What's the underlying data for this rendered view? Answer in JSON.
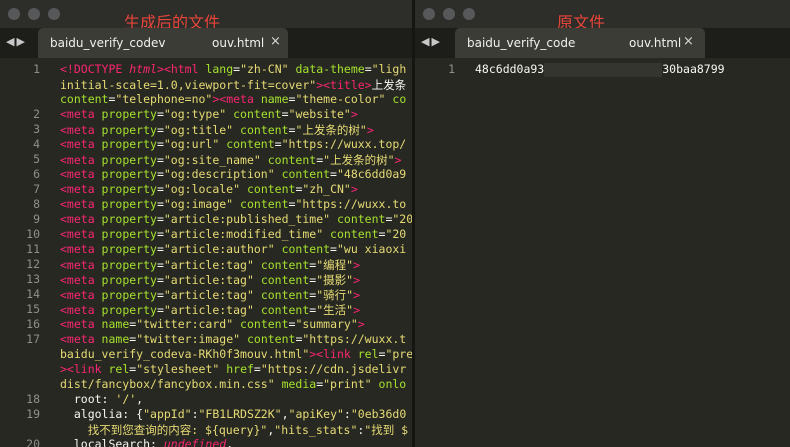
{
  "left_window": {
    "title": "生成后的文件",
    "tab_name_start": "baidu_verify_codev",
    "tab_name_end": "ouv.html",
    "close_icon": "×",
    "lines": [
      {
        "num": "1",
        "segments": [
          [
            "t",
            "<!DOCTYPE "
          ],
          [
            "i",
            "html"
          ],
          [
            "t",
            "><"
          ],
          [
            "t",
            "html "
          ],
          [
            "a",
            "lang"
          ],
          [
            "w",
            "="
          ],
          [
            "s",
            "\"zh-CN\" "
          ],
          [
            "a",
            "data-theme"
          ],
          [
            "w",
            "="
          ],
          [
            "s",
            "\"ligh"
          ]
        ]
      },
      {
        "num": "",
        "segments": [
          [
            "s",
            "initial-scale=1.0,viewport-fit=cover\""
          ],
          [
            "t",
            "><"
          ],
          [
            "t",
            "title"
          ],
          [
            "t",
            ">"
          ],
          [
            "w",
            "上发条"
          ]
        ]
      },
      {
        "num": "",
        "segments": [
          [
            "a",
            "content"
          ],
          [
            "w",
            "="
          ],
          [
            "s",
            "\"telephone=no\""
          ],
          [
            "t",
            "><"
          ],
          [
            "t",
            "meta "
          ],
          [
            "a",
            "name"
          ],
          [
            "w",
            "="
          ],
          [
            "s",
            "\"theme-color\" "
          ],
          [
            "a",
            "co"
          ]
        ]
      },
      {
        "num": "2",
        "segments": [
          [
            "t",
            "<meta "
          ],
          [
            "a",
            "property"
          ],
          [
            "w",
            "="
          ],
          [
            "s",
            "\"og:type\" "
          ],
          [
            "a",
            "content"
          ],
          [
            "w",
            "="
          ],
          [
            "s",
            "\"website\""
          ],
          [
            "t",
            ">"
          ]
        ]
      },
      {
        "num": "3",
        "segments": [
          [
            "t",
            "<meta "
          ],
          [
            "a",
            "property"
          ],
          [
            "w",
            "="
          ],
          [
            "s",
            "\"og:title\" "
          ],
          [
            "a",
            "content"
          ],
          [
            "w",
            "="
          ],
          [
            "s",
            "\"上发条的树\""
          ],
          [
            "t",
            ">"
          ]
        ]
      },
      {
        "num": "4",
        "segments": [
          [
            "t",
            "<meta "
          ],
          [
            "a",
            "property"
          ],
          [
            "w",
            "="
          ],
          [
            "s",
            "\"og:url\" "
          ],
          [
            "a",
            "content"
          ],
          [
            "w",
            "="
          ],
          [
            "s",
            "\"https://wuxx.top/"
          ]
        ]
      },
      {
        "num": "5",
        "segments": [
          [
            "t",
            "<meta "
          ],
          [
            "a",
            "property"
          ],
          [
            "w",
            "="
          ],
          [
            "s",
            "\"og:site_name\" "
          ],
          [
            "a",
            "content"
          ],
          [
            "w",
            "="
          ],
          [
            "s",
            "\"上发条的树\""
          ],
          [
            "t",
            "> "
          ]
        ]
      },
      {
        "num": "6",
        "segments": [
          [
            "t",
            "<meta "
          ],
          [
            "a",
            "property"
          ],
          [
            "w",
            "="
          ],
          [
            "s",
            "\"og:description\" "
          ],
          [
            "a",
            "content"
          ],
          [
            "w",
            "="
          ],
          [
            "s",
            "\"48c6dd0a9"
          ]
        ]
      },
      {
        "num": "7",
        "segments": [
          [
            "t",
            "<meta "
          ],
          [
            "a",
            "property"
          ],
          [
            "w",
            "="
          ],
          [
            "s",
            "\"og:locale\" "
          ],
          [
            "a",
            "content"
          ],
          [
            "w",
            "="
          ],
          [
            "s",
            "\"zh_CN\""
          ],
          [
            "t",
            ">"
          ]
        ]
      },
      {
        "num": "8",
        "segments": [
          [
            "t",
            "<meta "
          ],
          [
            "a",
            "property"
          ],
          [
            "w",
            "="
          ],
          [
            "s",
            "\"og:image\" "
          ],
          [
            "a",
            "content"
          ],
          [
            "w",
            "="
          ],
          [
            "s",
            "\"https://wuxx.to"
          ]
        ]
      },
      {
        "num": "9",
        "segments": [
          [
            "t",
            "<meta "
          ],
          [
            "a",
            "property"
          ],
          [
            "w",
            "="
          ],
          [
            "s",
            "\"article:published_time\" "
          ],
          [
            "a",
            "content"
          ],
          [
            "w",
            "="
          ],
          [
            "s",
            "\"20"
          ]
        ]
      },
      {
        "num": "10",
        "segments": [
          [
            "t",
            "<meta "
          ],
          [
            "a",
            "property"
          ],
          [
            "w",
            "="
          ],
          [
            "s",
            "\"article:modified_time\" "
          ],
          [
            "a",
            "content"
          ],
          [
            "w",
            "="
          ],
          [
            "s",
            "\"20"
          ]
        ]
      },
      {
        "num": "11",
        "segments": [
          [
            "t",
            "<meta "
          ],
          [
            "a",
            "property"
          ],
          [
            "w",
            "="
          ],
          [
            "s",
            "\"article:author\" "
          ],
          [
            "a",
            "content"
          ],
          [
            "w",
            "="
          ],
          [
            "s",
            "\"wu xiaoxi"
          ]
        ]
      },
      {
        "num": "12",
        "segments": [
          [
            "t",
            "<meta "
          ],
          [
            "a",
            "property"
          ],
          [
            "w",
            "="
          ],
          [
            "s",
            "\"article:tag\" "
          ],
          [
            "a",
            "content"
          ],
          [
            "w",
            "="
          ],
          [
            "s",
            "\"编程\""
          ],
          [
            "t",
            ">"
          ]
        ]
      },
      {
        "num": "13",
        "segments": [
          [
            "t",
            "<meta "
          ],
          [
            "a",
            "property"
          ],
          [
            "w",
            "="
          ],
          [
            "s",
            "\"article:tag\" "
          ],
          [
            "a",
            "content"
          ],
          [
            "w",
            "="
          ],
          [
            "s",
            "\"摄影\""
          ],
          [
            "t",
            ">"
          ]
        ]
      },
      {
        "num": "14",
        "segments": [
          [
            "t",
            "<meta "
          ],
          [
            "a",
            "property"
          ],
          [
            "w",
            "="
          ],
          [
            "s",
            "\"article:tag\" "
          ],
          [
            "a",
            "content"
          ],
          [
            "w",
            "="
          ],
          [
            "s",
            "\"骑行\""
          ],
          [
            "t",
            ">"
          ]
        ]
      },
      {
        "num": "15",
        "segments": [
          [
            "t",
            "<meta "
          ],
          [
            "a",
            "property"
          ],
          [
            "w",
            "="
          ],
          [
            "s",
            "\"article:tag\" "
          ],
          [
            "a",
            "content"
          ],
          [
            "w",
            "="
          ],
          [
            "s",
            "\"生活\""
          ],
          [
            "t",
            ">"
          ]
        ]
      },
      {
        "num": "16",
        "segments": [
          [
            "t",
            "<meta "
          ],
          [
            "a",
            "name"
          ],
          [
            "w",
            "="
          ],
          [
            "s",
            "\"twitter:card\" "
          ],
          [
            "a",
            "content"
          ],
          [
            "w",
            "="
          ],
          [
            "s",
            "\"summary\""
          ],
          [
            "t",
            ">"
          ]
        ]
      },
      {
        "num": "17",
        "segments": [
          [
            "t",
            "<meta "
          ],
          [
            "a",
            "name"
          ],
          [
            "w",
            "="
          ],
          [
            "s",
            "\"twitter:image\" "
          ],
          [
            "a",
            "content"
          ],
          [
            "w",
            "="
          ],
          [
            "s",
            "\"https://wuxx.t"
          ]
        ]
      },
      {
        "num": "",
        "segments": [
          [
            "s",
            "baidu_verify_codeva-RKh0f3mouv.html\""
          ],
          [
            "t",
            "><"
          ],
          [
            "t",
            "link "
          ],
          [
            "a",
            "rel"
          ],
          [
            "w",
            "="
          ],
          [
            "s",
            "\"pre"
          ]
        ]
      },
      {
        "num": "",
        "segments": [
          [
            "t",
            "><"
          ],
          [
            "t",
            "link "
          ],
          [
            "a",
            "rel"
          ],
          [
            "w",
            "="
          ],
          [
            "s",
            "\"stylesheet\" "
          ],
          [
            "a",
            "href"
          ],
          [
            "w",
            "="
          ],
          [
            "s",
            "\"https://cdn.jsdelivr"
          ]
        ]
      },
      {
        "num": "",
        "segments": [
          [
            "s",
            "dist/fancybox/fancybox.min.css\" "
          ],
          [
            "a",
            "media"
          ],
          [
            "w",
            "="
          ],
          [
            "s",
            "\"print\" "
          ],
          [
            "a",
            "onlo"
          ]
        ]
      },
      {
        "num": "18",
        "segments": [
          [
            "w",
            "  root: "
          ],
          [
            "s",
            "'/'"
          ],
          [
            "w",
            ","
          ]
        ]
      },
      {
        "num": "19",
        "segments": [
          [
            "w",
            "  algolia: {"
          ],
          [
            "s",
            "\"appId\""
          ],
          [
            "w",
            ":"
          ],
          [
            "s",
            "\"FB1LRDSZ2K\""
          ],
          [
            "w",
            ","
          ],
          [
            "s",
            "\"apiKey\""
          ],
          [
            "w",
            ":"
          ],
          [
            "s",
            "\"0eb36d0"
          ]
        ]
      },
      {
        "num": "",
        "segments": [
          [
            "s",
            "    找不到您查询的内容: ${query}\""
          ],
          [
            "w",
            ","
          ],
          [
            "s",
            "\"hits_stats\""
          ],
          [
            "w",
            ":"
          ],
          [
            "s",
            "\"找到 $"
          ]
        ]
      },
      {
        "num": "20",
        "segments": [
          [
            "w",
            "  localSearch: "
          ],
          [
            "i",
            "undefined"
          ],
          [
            "w",
            ","
          ]
        ]
      }
    ]
  },
  "right_window": {
    "title": "原文件",
    "tab_name_start": "baidu_verify_code",
    "tab_name_end": "ouv.html",
    "close_icon": "×",
    "lines": [
      {
        "num": "1",
        "segments": [
          [
            "w",
            "48c6dd0a93"
          ]
        ],
        "tail": "30baa8799"
      }
    ]
  },
  "icons": {
    "nav_back": "◀",
    "nav_forward": "▶"
  }
}
